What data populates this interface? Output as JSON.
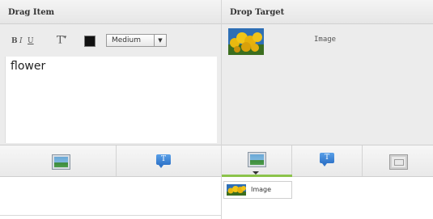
{
  "left_panel": {
    "title": "Drag Item",
    "toolbar": {
      "bold_label": "B",
      "italic_label": "I",
      "underline_label": "U",
      "font_size_label": "T",
      "font_size_sup": "▾",
      "color_swatch": "#111111",
      "size_select_value": "Medium",
      "size_select_arrow": "▼"
    },
    "editor_text": "flower"
  },
  "right_panel": {
    "title": "Drop Target",
    "preview_label": "Image"
  },
  "item_bar": {
    "left": [
      {
        "icon": "image-icon"
      },
      {
        "icon": "text-icon",
        "glyph": "T"
      }
    ],
    "right": [
      {
        "icon": "image-icon",
        "active": true
      },
      {
        "icon": "text-icon",
        "glyph": "T"
      },
      {
        "icon": "image-placeholder-icon"
      }
    ]
  },
  "dropdown_list": {
    "items": [
      {
        "label": "Image"
      }
    ]
  },
  "colors": {
    "active_accent": "#8bc34a",
    "panel_bg": "#ececec"
  }
}
